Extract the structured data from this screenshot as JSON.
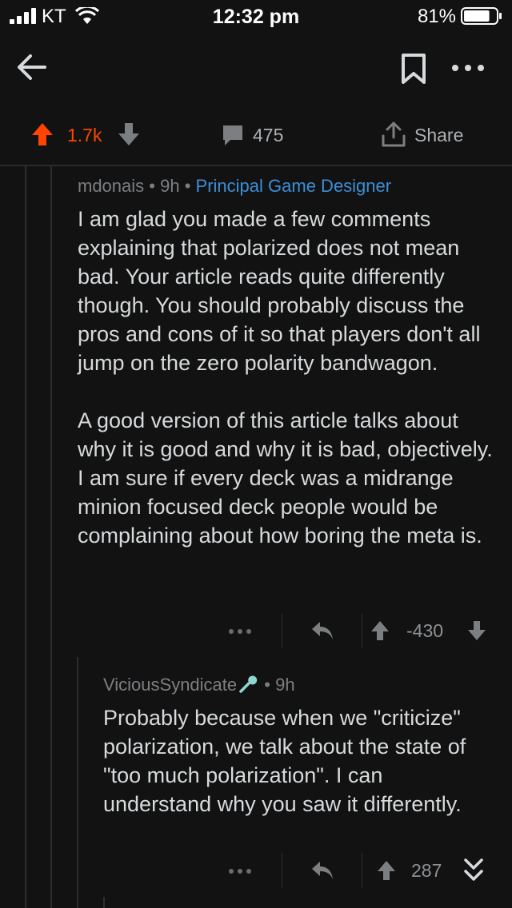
{
  "status_bar": {
    "carrier": "KT",
    "time": "12:32 pm",
    "battery": "81%",
    "battery_level": 0.81
  },
  "app_bar": {
    "icons": [
      "back-arrow-icon",
      "bookmark-icon",
      "more-icon"
    ]
  },
  "post_actions": {
    "score": "1.7k",
    "comments": "475",
    "share_label": "Share",
    "accent_color": "#ff4500"
  },
  "comments": [
    {
      "author": "mdonais",
      "sep1": "•",
      "age": "9h",
      "sep2": "•",
      "flair": "Principal Game Designer",
      "flair_color": "#3b8fd8",
      "paragraphs": [
        "I am glad you made a few comments explaining that polarized does not mean bad. Your article reads quite differently though. You should probably discuss the pros and cons of it so that players don't all jump on the zero polarity bandwagon.",
        "A good version of this article talks about why it is good and why it is bad, objectively. I am sure if every deck was a midrange minion focused deck people would be complaining about how boring the meta is."
      ],
      "score": "-430"
    },
    {
      "author": "ViciousSyndicate",
      "badge_icon": "microphone-icon",
      "sep": "•",
      "age": "9h",
      "paragraphs": [
        "Probably because when we \"criticize\" polarization, we talk about the state of \"too much polarization\". I can understand why you saw it differently."
      ],
      "score": "287"
    }
  ]
}
